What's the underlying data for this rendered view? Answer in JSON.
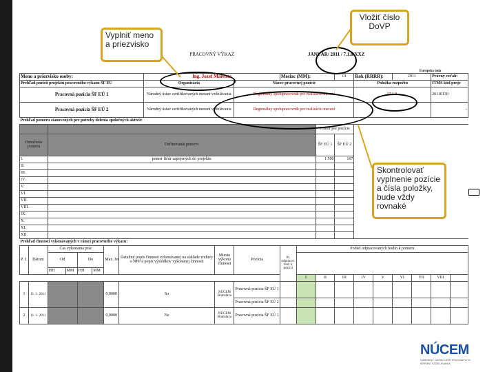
{
  "callouts": {
    "fill_name": "Vyplniť meno a priezvisko",
    "contract_no": "Vložiť číslo DoVP",
    "check": "Skontrolovať vyplnenie pozície a čísla položky, bude vždy rovnaké"
  },
  "form": {
    "title": "PRACOVNÝ VÝKAZ",
    "month_title": "JANUÁR/ 2011 / 7.1.8/XXZ",
    "eu_caption": "Európska únia",
    "name_label": "Meno a priezvisko osoby:",
    "name_value": "Ing. Jozef Malvista",
    "month_label": "Mesiac (MM):",
    "month_value": "01",
    "year_label": "Rok (RRRR):",
    "year_value": "2011",
    "relation_label": "Právny vzťah:",
    "hdr_row": [
      "Prehľad pozícií projektu pracovného výkazu ŠF EÚ",
      "Organizácia",
      "Názov pracovnej pozície",
      "Položka rozpočtu",
      "ITMS kód proje"
    ],
    "pos1_label": "Pracovná pozícia ŠF EÚ 1",
    "pos1_org": "Národný ústav certifikovaných meraní vzdelávania",
    "pos1_name": "Regionálny spolupracovník pre realizáciu meraní",
    "pos1_item": "17.1.8.",
    "pos1_itms": "26110130",
    "pos2_label": "Pracovná pozícia ŠF EÚ 2",
    "pos2_org": "Národný ústav certifikovaných meraní vzdelávania",
    "pos2_name": "Regionálny spolupracovník pre realizáciu meraní",
    "pos2_itms": "-",
    "overview_label": "Prehľad pomeru stanovených pre potreby delenia spoločných aktivít:",
    "col_marks": "Označenie pomeru",
    "col_def": "Definovanie pomeru",
    "col_ratio": "Pomer pre pozície",
    "col_sf1": "ŠF EÚ 1",
    "col_sf2": "ŠF EÚ 2",
    "rows": [
      {
        "no": "I.",
        "def": "pomer fičúr zapojených do projektu",
        "a": "1 500",
        "b": "167"
      },
      {
        "no": "II.",
        "def": "",
        "a": "",
        "b": ""
      },
      {
        "no": "III.",
        "def": "",
        "a": "",
        "b": ""
      },
      {
        "no": "IV.",
        "def": "",
        "a": "",
        "b": ""
      },
      {
        "no": "V.",
        "def": "",
        "a": "",
        "b": ""
      },
      {
        "no": "VI.",
        "def": "",
        "a": "",
        "b": ""
      },
      {
        "no": "VII.",
        "def": "",
        "a": "",
        "b": ""
      },
      {
        "no": "VIII.",
        "def": "",
        "a": "",
        "b": ""
      },
      {
        "no": "IX.",
        "def": "",
        "a": "",
        "b": ""
      },
      {
        "no": "X.",
        "def": "",
        "a": "",
        "b": ""
      },
      {
        "no": "XI.",
        "def": "",
        "a": "",
        "b": ""
      },
      {
        "no": "XII.",
        "def": "",
        "a": "",
        "b": ""
      }
    ],
    "activity_label": "Prehľad činností vykonávaných v rámci pracovného výkazu:",
    "act_hdr": {
      "pc": "P. č.",
      "date": "Dátum",
      "time": "Čas vykonania prác",
      "from": "Od",
      "to": "Do",
      "hh1": "HH",
      "mm1": "MM",
      "hh2": "HH",
      "mm2": "MM",
      "hours": "Max. hodín",
      "desc": "Detailný popis činnosti vykonávanej na základe zmluvy o NFP a popis výsledkov vykonanej činnosti",
      "place": "Miesto výkonu činnosti",
      "position": "Pozícia",
      "odprac": "Pr. odpracov. hod. k pozícii",
      "share": "Podiel odpracovaných hodín k pomeru",
      "roman": [
        "I",
        "II",
        "III",
        "IV",
        "V",
        "VI",
        "VII",
        "VIII"
      ]
    },
    "act_rows": [
      {
        "pc": "1",
        "date": "11. 1. 2011",
        "hours": "0,0000",
        "desc": "So",
        "place": "NÚCEM Bratislava",
        "pos_a": "Pracovná pozícia ŠF EÚ 1",
        "pos_b": "Pracovná pozícia ŠF EÚ 2"
      },
      {
        "pc": "2",
        "date": "11. 1. 2011",
        "hours": "0,0000",
        "desc": "Ne",
        "place": "NÚCEM Bratislava",
        "pos_a": "Pracovná pozícia ŠF EÚ 1",
        "pos_b": ""
      }
    ]
  },
  "footer": {
    "nucem": "NÚCEM",
    "nucem_sub": "NÁRODNÝ ÚSTAV CERTIFIKOVANÝCH MERANÍ VZDELÁVANIA"
  },
  "colors": {
    "callout_border": "#d9a521",
    "sidebar": "#1a1a1a",
    "nucem_blue": "#1a4fa0",
    "eu_blue": "#1f3f8f"
  }
}
